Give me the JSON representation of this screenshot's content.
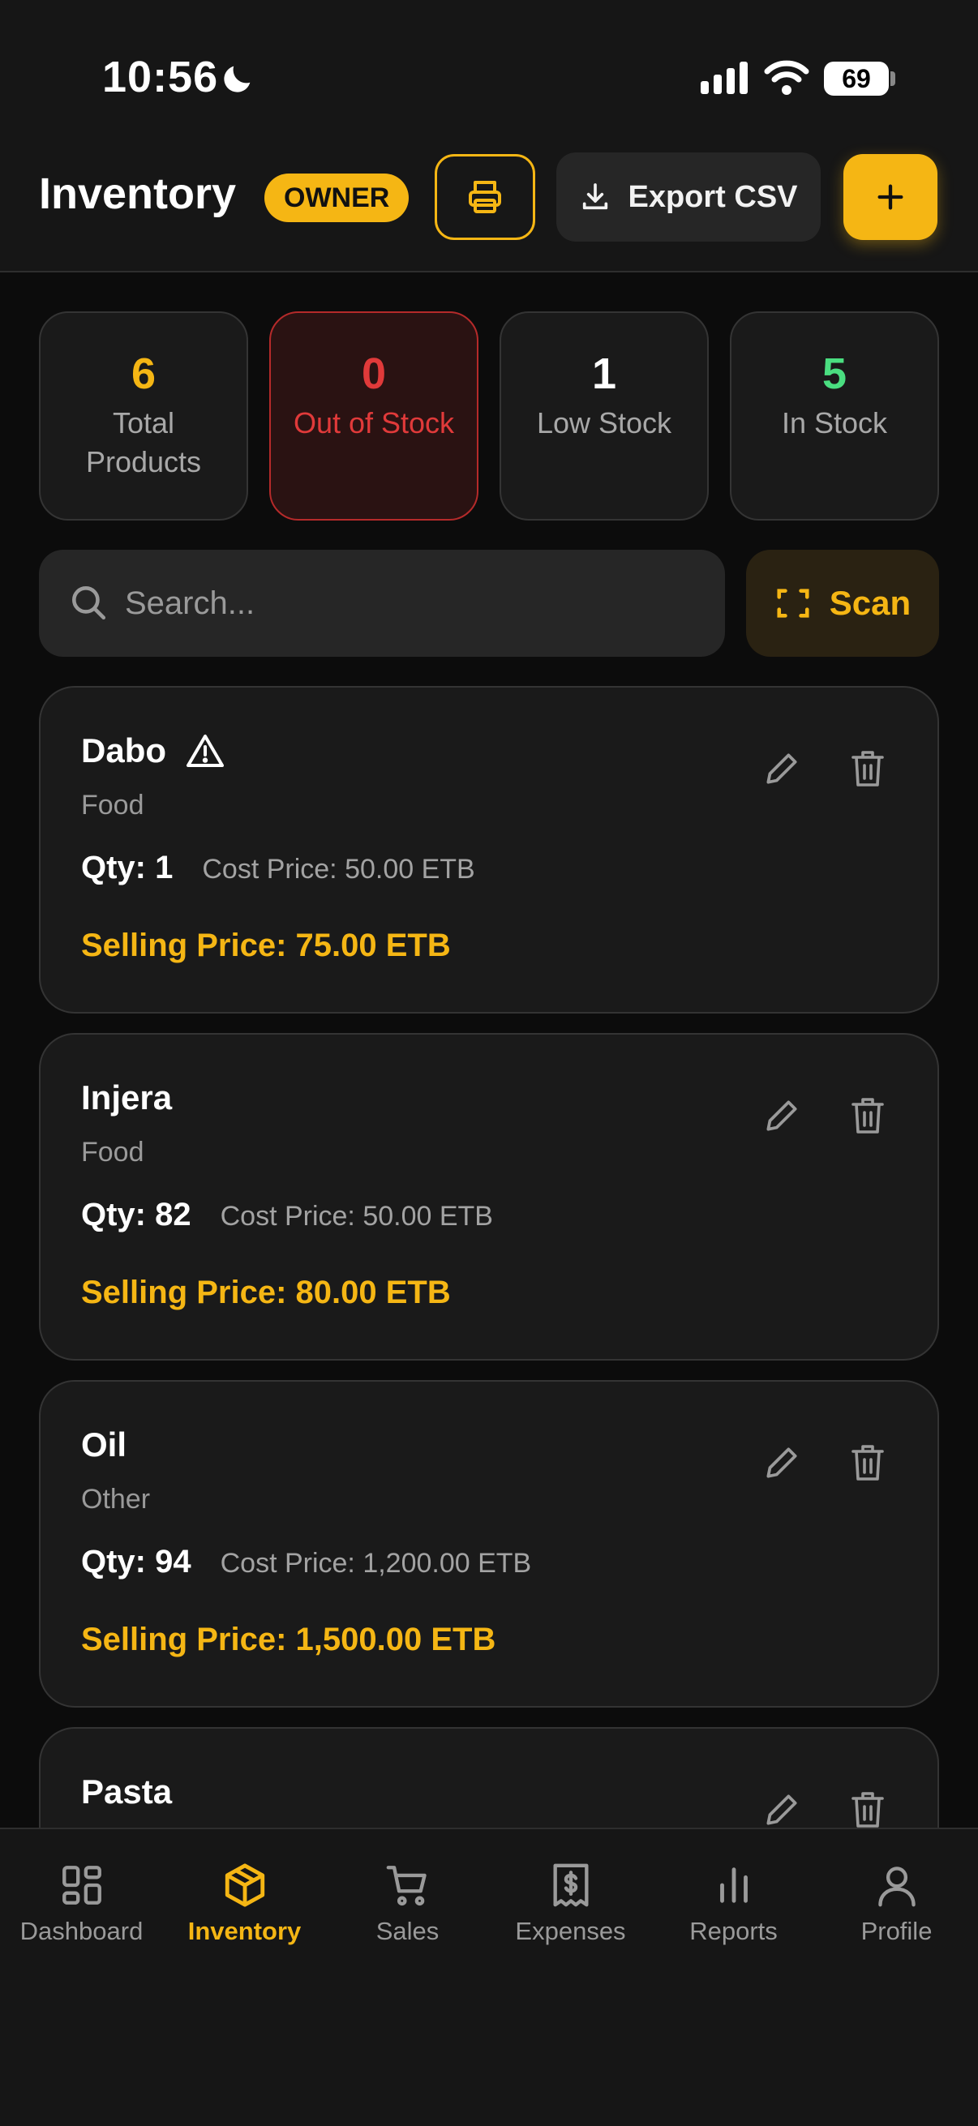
{
  "status_bar": {
    "time": "10:56",
    "battery": "69"
  },
  "header": {
    "title": "Inventory",
    "role_badge": "OWNER",
    "export_label": "Export CSV"
  },
  "stats": [
    {
      "value": "6",
      "label": "Total Products",
      "color": "#f5b614"
    },
    {
      "value": "0",
      "label": "Out of Stock",
      "color": "#e03a3a"
    },
    {
      "value": "1",
      "label": "Low Stock",
      "color": "#ffffff"
    },
    {
      "value": "5",
      "label": "In Stock",
      "color": "#4ade80"
    }
  ],
  "search": {
    "placeholder": "Search...",
    "scan_label": "Scan"
  },
  "products": [
    {
      "name": "Dabo",
      "warning": true,
      "category": "Food",
      "qty": "Qty: 1",
      "cost": "Cost Price: 50.00 ETB",
      "selling": "Selling Price: 75.00 ETB"
    },
    {
      "name": "Injera",
      "warning": false,
      "category": "Food",
      "qty": "Qty: 82",
      "cost": "Cost Price: 50.00 ETB",
      "selling": "Selling Price: 80.00 ETB"
    },
    {
      "name": "Oil",
      "warning": false,
      "category": "Other",
      "qty": "Qty: 94",
      "cost": "Cost Price: 1,200.00 ETB",
      "selling": "Selling Price: 1,500.00 ETB"
    },
    {
      "name": "Pasta",
      "warning": false,
      "category": "",
      "qty": "",
      "cost": "",
      "selling": ""
    }
  ],
  "nav": [
    {
      "label": "Dashboard",
      "icon": "grid-icon",
      "active": false
    },
    {
      "label": "Inventory",
      "icon": "box-icon",
      "active": true
    },
    {
      "label": "Sales",
      "icon": "cart-icon",
      "active": false
    },
    {
      "label": "Expenses",
      "icon": "receipt-icon",
      "active": false
    },
    {
      "label": "Reports",
      "icon": "bar-chart-icon",
      "active": false
    },
    {
      "label": "Profile",
      "icon": "user-icon",
      "active": false
    }
  ],
  "colors": {
    "accent": "#f5b614",
    "danger": "#e03a3a",
    "success": "#4ade80"
  }
}
